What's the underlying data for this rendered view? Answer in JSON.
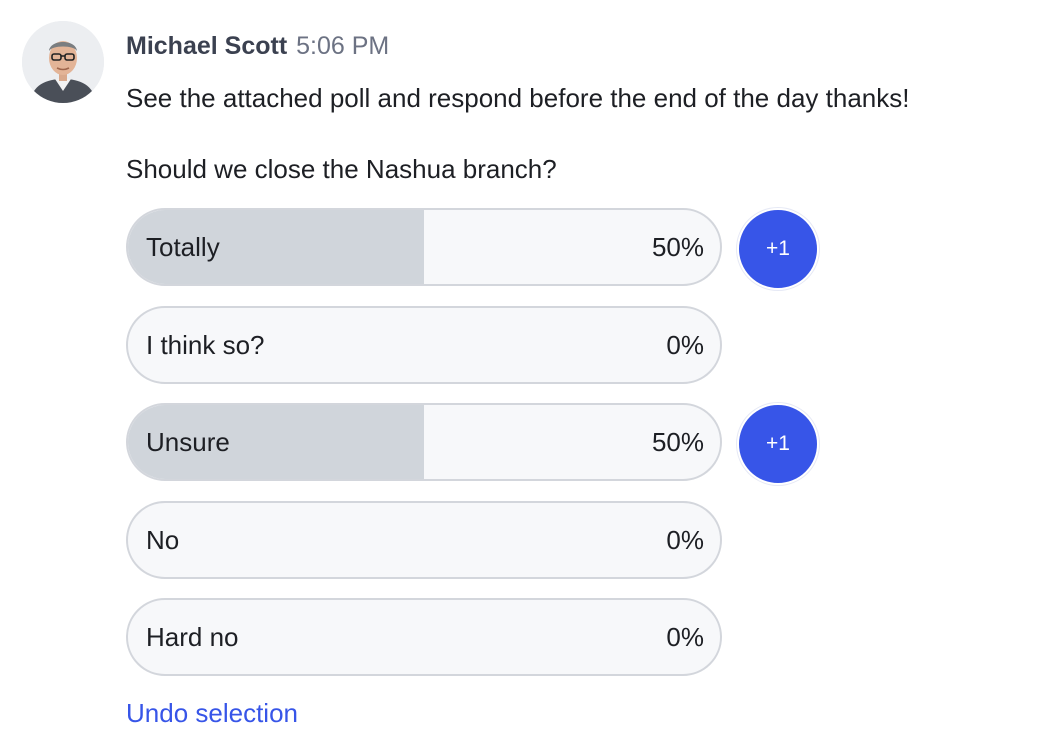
{
  "message": {
    "author": "Michael Scott",
    "time": "5:06 PM",
    "text": "See the attached poll and respond before the end of the day thanks!",
    "avatar_icon": "user-avatar-photo"
  },
  "poll": {
    "question": "Should we close the Nashua branch?",
    "options": [
      {
        "label": "Totally",
        "percent": "50%",
        "fraction": 0.5,
        "votes_badge": "+1"
      },
      {
        "label": "I think so?",
        "percent": "0%",
        "fraction": 0,
        "votes_badge": ""
      },
      {
        "label": "Unsure",
        "percent": "50%",
        "fraction": 0.5,
        "votes_badge": "+1"
      },
      {
        "label": "No",
        "percent": "0%",
        "fraction": 0,
        "votes_badge": ""
      },
      {
        "label": "Hard no",
        "percent": "0%",
        "fraction": 0,
        "votes_badge": ""
      }
    ],
    "undo_label": "Undo selection"
  },
  "colors": {
    "accent": "#3755e8",
    "bar_fill": "#d0d5db",
    "pill_bg": "#f7f8fa",
    "pill_border": "#d3d6dc"
  }
}
